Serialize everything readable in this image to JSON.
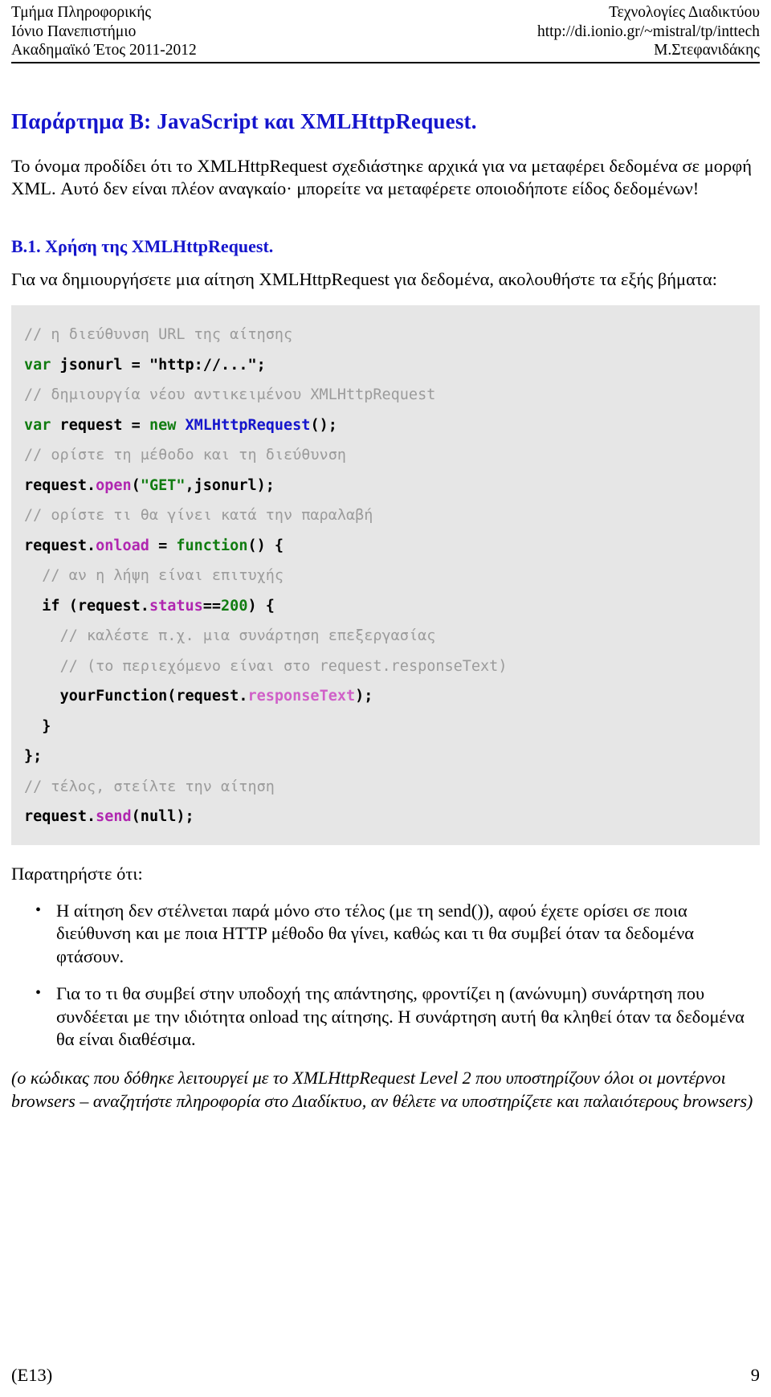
{
  "header": {
    "left": [
      "Τμήμα Πληροφορικής",
      "Ιόνιο Πανεπιστήμιο",
      "Ακαδημαϊκό Έτος 2011-2012"
    ],
    "right": [
      "Τεχνολογίες Διαδικτύου",
      "http://di.ionio.gr/~mistral/tp/inttech",
      "Μ.Στεφανιδάκης"
    ]
  },
  "title": "Παράρτημα Β:  JavaScript και XMLHttpRequest.",
  "intro_paragraph": "Το όνομα προδίδει ότι το XMLHttpRequest σχεδιάστηκε αρχικά για να μεταφέρει δεδομένα σε μορφή XML. Αυτό δεν είναι πλέον αναγκαίο· μπορείτε να μεταφέρετε οποιοδήποτε είδος δεδομένων!",
  "section": {
    "title": "Β.1. Χρήση της XMLHttpRequest.",
    "lead": "Για να δημιουργήσετε μια αίτηση XMLHttpRequest  για δεδομένα, ακολουθήστε τα εξής βήματα:"
  },
  "code": {
    "language": "javascript",
    "background_color": "#e6e6e6",
    "colors": {
      "comment": "#9b9b9b",
      "keyword": "#107c10",
      "type": "#1414cc",
      "method": "#b026b0",
      "property": "#d060c8",
      "string": "#107c10",
      "number": "#107c10",
      "plain": "#000000"
    },
    "lines": [
      {
        "indent": 0,
        "tokens": [
          {
            "t": "comment",
            "v": "// η διεύθυνση URL της αίτησης"
          }
        ]
      },
      {
        "indent": 0,
        "tokens": [
          {
            "t": "keyword",
            "v": "var"
          },
          {
            "t": "plain",
            "v": " jsonurl = "
          },
          {
            "t": "plain",
            "v": "\"http://...\";"
          }
        ]
      },
      {
        "indent": 0,
        "tokens": [
          {
            "t": "comment",
            "v": "// δημιουργία νέου αντικειμένου XMLHttpRequest"
          }
        ]
      },
      {
        "indent": 0,
        "tokens": [
          {
            "t": "keyword",
            "v": "var"
          },
          {
            "t": "plain",
            "v": " request = "
          },
          {
            "t": "keyword",
            "v": "new"
          },
          {
            "t": "plain",
            "v": " "
          },
          {
            "t": "type",
            "v": "XMLHttpRequest"
          },
          {
            "t": "plain",
            "v": "();"
          }
        ]
      },
      {
        "indent": 0,
        "tokens": [
          {
            "t": "comment",
            "v": "// ορίστε τη μέθοδο και τη διεύθυνση"
          }
        ]
      },
      {
        "indent": 0,
        "tokens": [
          {
            "t": "plain",
            "v": "request."
          },
          {
            "t": "method",
            "v": "open"
          },
          {
            "t": "plain",
            "v": "("
          },
          {
            "t": "string",
            "v": "\"GET\""
          },
          {
            "t": "plain",
            "v": ",jsonurl);"
          }
        ]
      },
      {
        "indent": 0,
        "tokens": [
          {
            "t": "comment",
            "v": "// ορίστε τι θα γίνει κατά την παραλαβή"
          }
        ]
      },
      {
        "indent": 0,
        "tokens": [
          {
            "t": "plain",
            "v": "request."
          },
          {
            "t": "method",
            "v": "onload"
          },
          {
            "t": "plain",
            "v": " = "
          },
          {
            "t": "keyword",
            "v": "function"
          },
          {
            "t": "plain",
            "v": "() {"
          }
        ]
      },
      {
        "indent": 1,
        "tokens": [
          {
            "t": "comment",
            "v": "// αν η λήψη είναι επιτυχής"
          }
        ]
      },
      {
        "indent": 1,
        "tokens": [
          {
            "t": "plain",
            "v": "if (request."
          },
          {
            "t": "method",
            "v": "status"
          },
          {
            "t": "plain",
            "v": "=="
          },
          {
            "t": "number",
            "v": "200"
          },
          {
            "t": "plain",
            "v": ") {"
          }
        ]
      },
      {
        "indent": 2,
        "tokens": [
          {
            "t": "comment",
            "v": "// καλέστε π.χ. μια συνάρτηση επεξεργασίας"
          }
        ]
      },
      {
        "indent": 2,
        "tokens": [
          {
            "t": "comment",
            "v": "// (το περιεχόμενο είναι στο request.responseText)"
          }
        ]
      },
      {
        "indent": 2,
        "tokens": [
          {
            "t": "plain",
            "v": "yourFunction(request."
          },
          {
            "t": "prop",
            "v": "responseText"
          },
          {
            "t": "plain",
            "v": ");"
          }
        ]
      },
      {
        "indent": 1,
        "tokens": [
          {
            "t": "plain",
            "v": "}"
          }
        ]
      },
      {
        "indent": 0,
        "tokens": [
          {
            "t": "plain",
            "v": "};"
          }
        ]
      },
      {
        "indent": 0,
        "tokens": [
          {
            "t": "comment",
            "v": "// τέλος, στείλτε την αίτηση"
          }
        ]
      },
      {
        "indent": 0,
        "tokens": [
          {
            "t": "plain",
            "v": "request."
          },
          {
            "t": "method",
            "v": "send"
          },
          {
            "t": "plain",
            "v": "(null);"
          }
        ]
      }
    ]
  },
  "notes_label": "Παρατηρήστε ότι:",
  "notes": [
    "Η αίτηση δεν στέλνεται παρά μόνο στο τέλος (με τη send()), αφού έχετε ορίσει σε ποια διεύθυνση και με ποια HTTP μέθοδο θα γίνει, καθώς και τι θα συμβεί όταν τα δεδομένα φτάσουν.",
    "Για το τι θα συμβεί στην υποδοχή της απάντησης, φροντίζει η (ανώνυμη) συνάρτηση που συνδέεται με την ιδιότητα onload της αίτησης. Η συνάρτηση αυτή θα κληθεί όταν τα δεδομένα θα είναι διαθέσιμα."
  ],
  "bullet_glyph": "•",
  "closing_note": "(ο κώδικας που δόθηκε λειτουργεί με το XMLHttpRequest Level 2 που υποστηρίζουν όλοι οι μοντέρνοι browsers – αναζητήστε πληροφορία στο Διαδίκτυο, αν θέλετε να υποστηρίζετε και παλαιότερους browsers)",
  "footer": {
    "left": "(E13)",
    "right": "9"
  },
  "theme": {
    "heading_color": "#1414cc",
    "text_color": "#000000",
    "page_background": "#ffffff"
  }
}
